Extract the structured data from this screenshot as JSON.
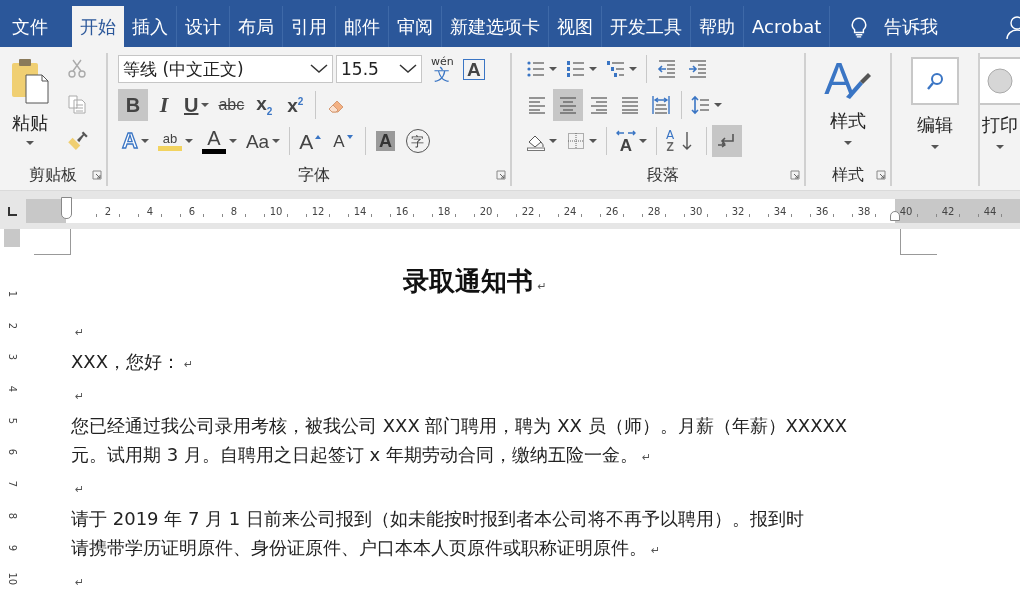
{
  "tabs": [
    {
      "label": "文件",
      "selected": false
    },
    {
      "label": "开始",
      "selected": true
    },
    {
      "label": "插入",
      "selected": false
    },
    {
      "label": "设计",
      "selected": false
    },
    {
      "label": "布局",
      "selected": false
    },
    {
      "label": "引用",
      "selected": false
    },
    {
      "label": "邮件",
      "selected": false
    },
    {
      "label": "审阅",
      "selected": false
    },
    {
      "label": "新建选项卡",
      "selected": false
    },
    {
      "label": "视图",
      "selected": false
    },
    {
      "label": "开发工具",
      "selected": false
    },
    {
      "label": "帮助",
      "selected": false
    },
    {
      "label": "Acrobat",
      "selected": false
    }
  ],
  "tell_me": {
    "label": "告诉我"
  },
  "ribbon": {
    "clipboard": {
      "label": "剪贴板",
      "paste": "粘贴"
    },
    "font": {
      "label": "字体",
      "font_name": "等线 (中文正文)",
      "font_size": "15.5",
      "rows": [
        {
          "buttons": [
            {
              "kind": "phonetic",
              "top": "wén",
              "glyph": "文"
            },
            {
              "kind": "boxed",
              "glyph": "A"
            }
          ]
        },
        {
          "buttons": [
            {
              "kind": "bold",
              "glyph": "B",
              "on": true
            },
            {
              "kind": "italic",
              "glyph": "I",
              "on": false
            },
            {
              "kind": "underline",
              "glyph": "U",
              "on": false,
              "dropdown": true
            },
            {
              "kind": "strikethrough",
              "glyph": "abc",
              "on": false
            },
            {
              "kind": "subscript",
              "glyph": "x$_{2}$",
              "on": false
            },
            {
              "kind": "superscript",
              "glyph": "x$^{2}$",
              "on": false
            },
            {
              "kind": "separator"
            },
            {
              "kind": "eraser"
            }
          ]
        },
        {
          "buttons": [
            {
              "kind": "text_effect",
              "glyph": "A",
              "dropdown": true
            },
            {
              "kind": "highlight",
              "glyph": "ab",
              "color": "#f2d35f",
              "dropdown": true
            },
            {
              "kind": "font_color",
              "glyph": "A",
              "color": "#000000",
              "dropdown": true
            },
            {
              "kind": "change_case",
              "glyph": "Aa",
              "dropdown": true
            },
            {
              "kind": "separator"
            },
            {
              "kind": "grow",
              "glyph": "A"
            },
            {
              "kind": "shrink",
              "glyph": "A"
            },
            {
              "kind": "separator"
            },
            {
              "kind": "char_shading",
              "glyph": "A"
            },
            {
              "kind": "enclose",
              "glyph": "字"
            }
          ]
        }
      ]
    },
    "paragraph": {
      "label": "段落",
      "rows": [
        {
          "buttons": [
            {
              "kind": "bullets",
              "dropdown": true
            },
            {
              "kind": "numbering",
              "dropdown": true
            },
            {
              "kind": "multilevel",
              "dropdown": true
            },
            {
              "kind": "separator"
            },
            {
              "kind": "outdent"
            },
            {
              "kind": "indent"
            }
          ]
        },
        {
          "buttons": [
            {
              "kind": "align_left",
              "on": false
            },
            {
              "kind": "align_center",
              "on": true
            },
            {
              "kind": "align_right",
              "on": false
            },
            {
              "kind": "justify",
              "on": false
            },
            {
              "kind": "distribute",
              "on": false
            },
            {
              "kind": "separator"
            },
            {
              "kind": "line_spacing",
              "dropdown": true
            }
          ]
        },
        {
          "buttons": [
            {
              "kind": "shading",
              "dropdown": true
            },
            {
              "kind": "borders",
              "dropdown": true
            },
            {
              "kind": "separator"
            },
            {
              "kind": "asian_layout",
              "glyph": "A",
              "dropdown": true
            },
            {
              "kind": "separator"
            },
            {
              "kind": "sort",
              "top": "A",
              "glyph": "Z"
            },
            {
              "kind": "separator"
            },
            {
              "kind": "show_marks",
              "on": true
            }
          ]
        }
      ]
    },
    "styles": {
      "label": "样式",
      "glyph": "A",
      "button": "样式"
    },
    "editing": {
      "button": "编辑"
    },
    "preview": {
      "button": "打印"
    }
  },
  "ruler": {
    "labels": [
      "2",
      "4",
      "6",
      "8",
      "10",
      "12",
      "14",
      "16",
      "18",
      "20",
      "22",
      "24",
      "26",
      "28",
      "30",
      "32",
      "34",
      "36",
      "38",
      "40",
      "42",
      "44"
    ],
    "vertical_labels": [
      "1",
      "2",
      "3",
      "4",
      "5",
      "6",
      "7",
      "8",
      "9",
      "10"
    ]
  },
  "document": {
    "paragraphs": [
      {
        "kind": "title",
        "text": "录取通知书",
        "mark": "↵"
      },
      {
        "kind": "body",
        "mark": "↵"
      },
      {
        "kind": "body",
        "text": "XXX，您好：",
        "mark": "↵"
      },
      {
        "kind": "body",
        "mark": "↵"
      },
      {
        "kind": "body",
        "lines": [
          "您已经通过我公司录用考核，被我公司 XXX 部门聘用，聘为 XX 员（师）。月薪（年薪）XXXXX",
          "元。试用期 3 月。自聘用之日起签订 x 年期劳动合同，缴纳五险一金。"
        ],
        "mark": "↵"
      },
      {
        "kind": "body",
        "mark": "↵"
      },
      {
        "kind": "body",
        "lines": [
          "请于 2019 年 7 月 1 日前来公司报到（如未能按时报到者本公司将不再予以聘用）。报到时",
          "请携带学历证明原件、身份证原件、户口本本人页原件或职称证明原件。"
        ],
        "mark": "↵"
      },
      {
        "kind": "body",
        "mark": "↵"
      }
    ]
  }
}
